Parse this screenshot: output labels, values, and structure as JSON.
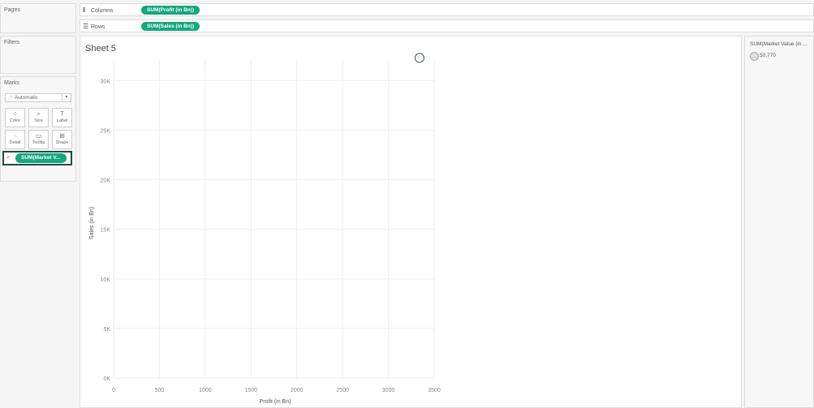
{
  "side": {
    "pages_title": "Pages",
    "filters_title": "Filters",
    "marks_title": "Marks",
    "marks_type": "Automatic",
    "buttons": [
      {
        "label": "Color",
        "glyph": "⁘"
      },
      {
        "label": "Size",
        "glyph": "⌕"
      },
      {
        "label": "Label",
        "glyph": "T"
      },
      {
        "label": "Detail",
        "glyph": "⁖"
      },
      {
        "label": "Tooltip",
        "glyph": "▭"
      },
      {
        "label": "Shape",
        "glyph": "⊞"
      }
    ],
    "size_pill": "SUM(Market V..."
  },
  "shelves": {
    "columns_label": "Columns",
    "columns_pill": "SUM(Profit (in Bn))",
    "rows_label": "Rows",
    "rows_pill": "SUM(Sales (in Bn))"
  },
  "sheet": {
    "title": "Sheet 5"
  },
  "legend": {
    "title": "SUM(Market Value (in ...",
    "item": "50,770"
  },
  "chart_data": {
    "type": "scatter",
    "xlabel": "Profit (in Bn)",
    "ylabel": "Sales (in Bn)",
    "xlim": [
      0,
      3500
    ],
    "ylim": [
      0,
      32000
    ],
    "x_ticks": [
      "0",
      "500",
      "1000",
      "1500",
      "2000",
      "2500",
      "3000",
      "3500"
    ],
    "x_tick_values": [
      0,
      500,
      1000,
      1500,
      2000,
      2500,
      3000,
      3500
    ],
    "y_ticks": [
      "0K",
      "5K",
      "10K",
      "15K",
      "20K",
      "25K",
      "30K"
    ],
    "y_tick_values": [
      0,
      5000,
      10000,
      15000,
      20000,
      25000,
      30000
    ],
    "points": [
      {
        "x": 3340,
        "y": 32300
      }
    ],
    "grid": true,
    "point_color": "#4f6f6a"
  }
}
